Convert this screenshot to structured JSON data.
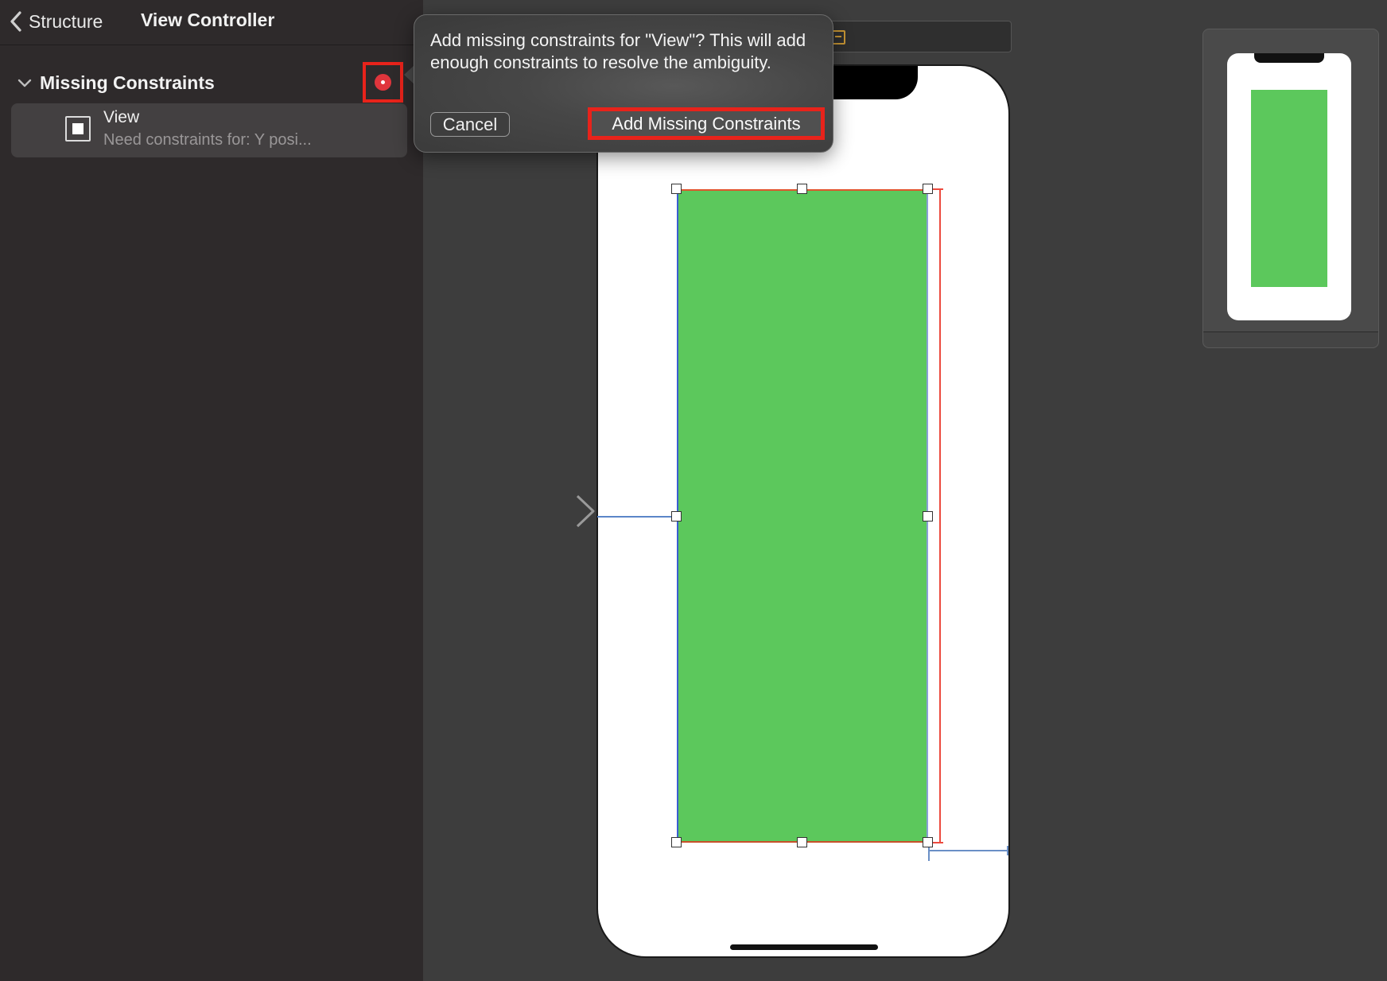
{
  "header": {
    "back_label": "Structure",
    "title": "View Controller"
  },
  "section": {
    "title": "Missing Constraints"
  },
  "issue": {
    "title": "View",
    "subtitle": "Need constraints for: Y posi..."
  },
  "popover": {
    "message": "Add missing constraints for \"View\"? This will add enough constraints to resolve the ambiguity.",
    "cancel_label": "Cancel",
    "confirm_label": "Add Missing Constraints"
  },
  "colors": {
    "sidebar_bg": "#2e2a2b",
    "canvas_bg": "#3d3d3d",
    "view_green": "#5cc85c",
    "error_red": "#e0353c",
    "highlight_red": "#e8231b",
    "constraint_blue": "#5b86c8"
  },
  "icons": {
    "back": "chevron-left-icon",
    "disclosure": "chevron-down-icon",
    "resolve": "error-dot-icon",
    "view": "view-square-icon",
    "scene_exit": "exit-icon",
    "entry_point": "arrow-right-icon"
  }
}
